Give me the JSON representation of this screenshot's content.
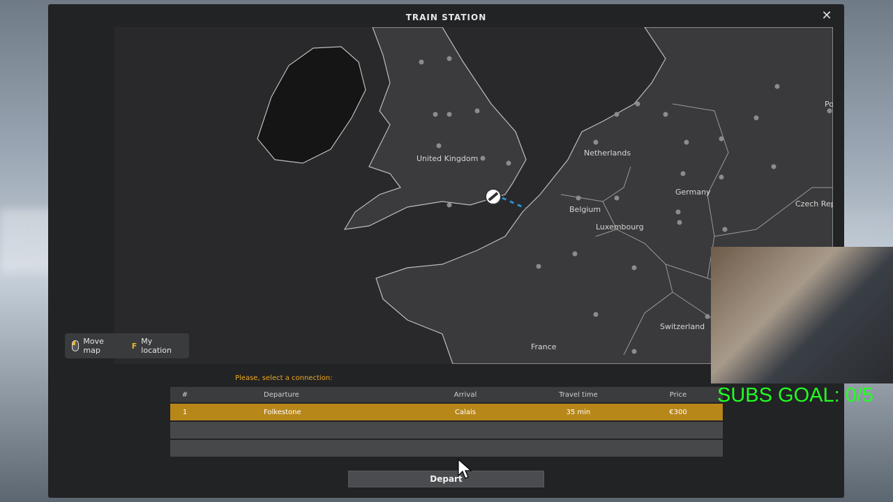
{
  "window": {
    "title": "TRAIN STATION",
    "close_icon": "close-icon"
  },
  "map": {
    "labels": {
      "uk": "United Kingdom",
      "netherlands": "Netherlands",
      "germany": "Germany",
      "belgium": "Belgium",
      "luxembourg": "Luxembourg",
      "czech": "Czech Republic",
      "france": "France",
      "switzerland": "Switzerland",
      "po": "Po"
    }
  },
  "hints": {
    "move_map": "Move map",
    "location_key": "F",
    "my_location": "My location"
  },
  "connections": {
    "prompt": "Please, select a connection:",
    "headers": {
      "num": "#",
      "departure": "Departure",
      "arrival": "Arrival",
      "travel_time": "Travel time",
      "price": "Price"
    },
    "rows": [
      {
        "num": "1",
        "departure": "Folkestone",
        "arrival": "Calais",
        "travel_time": "35 min",
        "price": "€300"
      }
    ]
  },
  "depart_label": "Depart",
  "overlay": {
    "subs_goal": "SUBS GOAL: 0/5"
  },
  "colors": {
    "accent": "#f0a71e",
    "selected_row": "#b8871a",
    "subs": "#22ff22"
  }
}
